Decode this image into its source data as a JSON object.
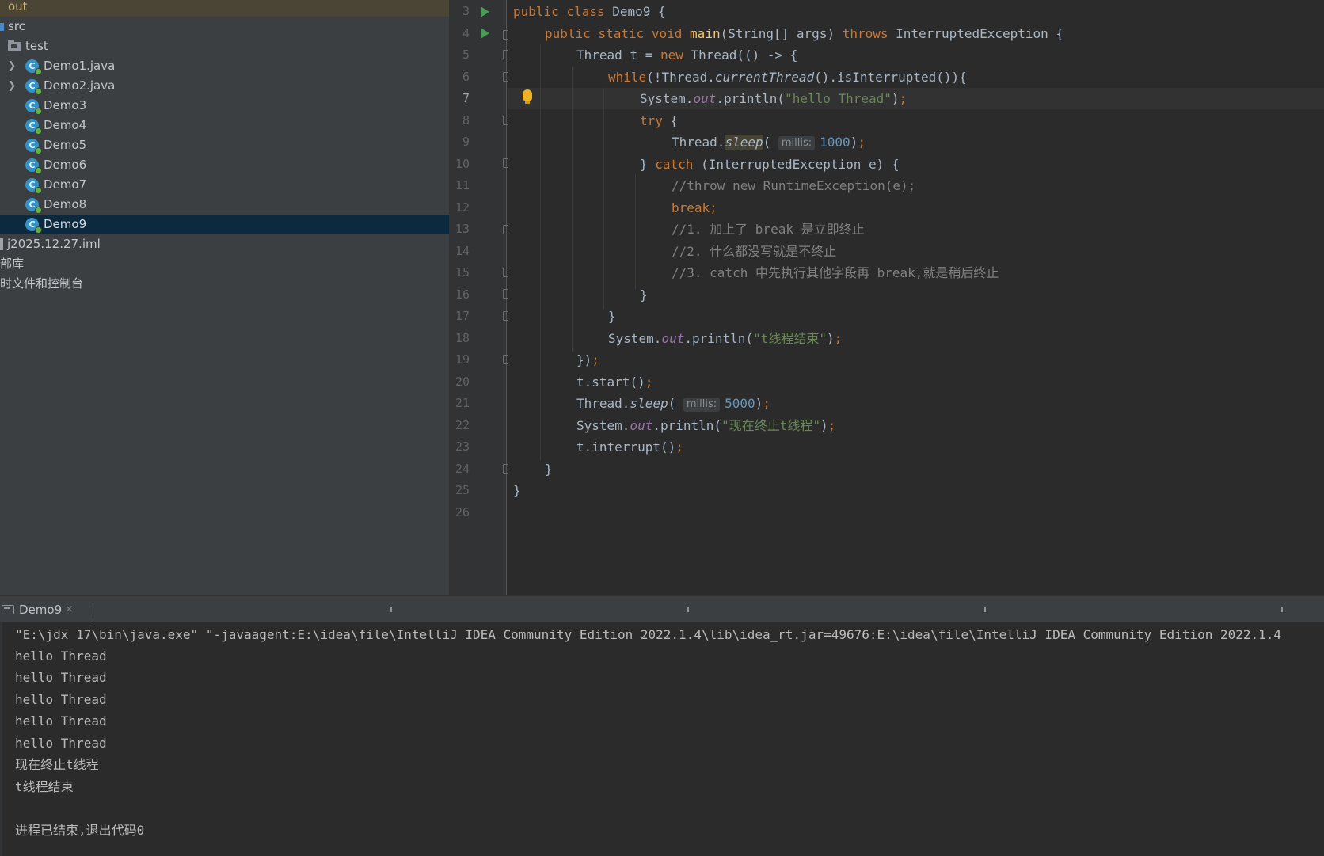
{
  "project_tree": {
    "out_label": "out",
    "src_label": "src",
    "test_label": "test",
    "classes": [
      "Demo1.java",
      "Demo2.java",
      "Demo3",
      "Demo4",
      "Demo5",
      "Demo6",
      "Demo7",
      "Demo8",
      "Demo9"
    ],
    "class_icon_letter": "C",
    "selected": "Demo9",
    "iml_file": "j2025.12.27.iml",
    "external_libraries": "部库",
    "scratches": "时文件和控制台"
  },
  "editor": {
    "line_numbers": [
      "3",
      "4",
      "5",
      "6",
      "7",
      "8",
      "9",
      "10",
      "11",
      "12",
      "13",
      "14",
      "15",
      "16",
      "17",
      "18",
      "19",
      "20",
      "21",
      "22",
      "23",
      "24",
      "25",
      "26"
    ],
    "current_line": "7",
    "code": {
      "public": "public",
      "class": "class",
      "static": "static",
      "void": "void",
      "main": "main",
      "throws": "throws",
      "new": "new",
      "while": "while",
      "try": "try",
      "catch": "catch",
      "break": "break",
      "class_name": "Demo9",
      "String_arr": "String[] args",
      "InterruptedException": "InterruptedException",
      "Thread": "Thread",
      "t": "t",
      "System": "System",
      "out": "out",
      "println": "println",
      "currentThread": "currentThread",
      "isInterrupted": "isInterrupted",
      "sleep": "sleep",
      "start": "start",
      "interrupt": "interrupt",
      "e": "e",
      "hint_millis": "millis:",
      "num_1000": "1000",
      "num_5000": "5000",
      "str_hello": "\"hello Thread\"",
      "str_t_end": "\"t线程结束\"",
      "str_now_stop": "\"现在终止t线程\"",
      "comment_throw": "//throw new RuntimeException(e);",
      "comment_1": "//1. 加上了 break 是立即终止",
      "comment_2": "//2. 什么都没写就是不终止",
      "comment_3": "//3. catch 中先执行其他字段再 break,就是稍后终止"
    }
  },
  "run_panel": {
    "tab_label": "Demo9",
    "close_glyph": "×",
    "output": [
      "\"E:\\jdx 17\\bin\\java.exe\" \"-javaagent:E:\\idea\\file\\IntelliJ IDEA Community Edition 2022.1.4\\lib\\idea_rt.jar=49676:E:\\idea\\file\\IntelliJ IDEA Community Edition 2022.1.4",
      "hello Thread",
      "hello Thread",
      "hello Thread",
      "hello Thread",
      "hello Thread",
      "现在终止t线程",
      "t线程结束",
      "",
      "进程已结束,退出代码0"
    ]
  },
  "colors": {
    "keyword": "#cc7832",
    "method_decl": "#ffc66d",
    "string": "#6a8759",
    "number": "#6897bb",
    "static_field": "#9876aa",
    "comment": "#808080",
    "selection": "#0d293e",
    "run_icon": "#499c54",
    "class_icon": "#3592c4"
  },
  "icons": {
    "run_gutter": "run-icon",
    "fold_marker": "fold-icon",
    "intention": "lightbulb-icon",
    "java_class": "java-class-icon",
    "folder": "folder-icon",
    "console_tab": "terminal-icon",
    "expand": "chevron-right-icon"
  }
}
